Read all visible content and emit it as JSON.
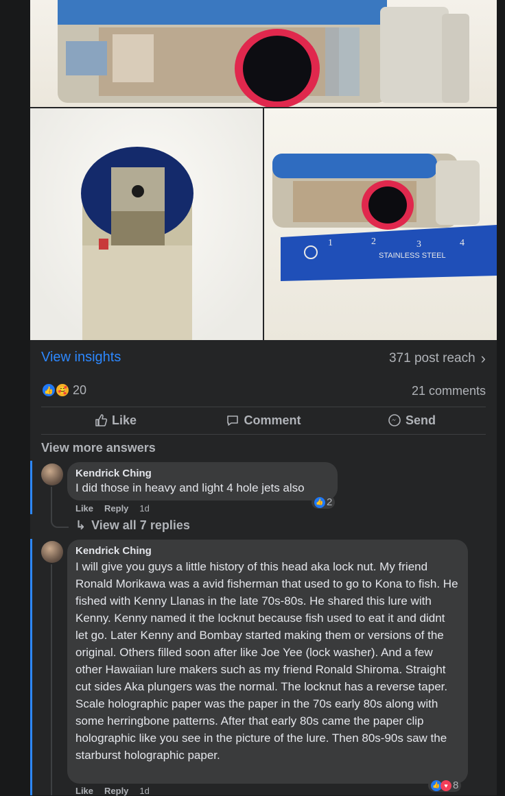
{
  "post": {
    "insights_label": "View insights",
    "reach": "371 post reach",
    "reaction_count": "20",
    "comments_count": "21 comments",
    "actions": {
      "like": "Like",
      "comment": "Comment",
      "send": "Send"
    },
    "ruler_text": "STAINLESS STEEL",
    "ruler_numbers": [
      "1",
      "2",
      "3",
      "4"
    ]
  },
  "comments_section": {
    "view_more": "View more answers",
    "comments": [
      {
        "author": "Kendrick Ching",
        "text": "I did those in heavy and light 4 hole jets also",
        "like": "Like",
        "reply": "Reply",
        "time": "1d",
        "reaction_count": "2",
        "view_replies": "View all 7 replies"
      },
      {
        "author": "Kendrick Ching",
        "text": "I will give you guys a little history of this head aka lock nut. My friend Ronald Morikawa was a avid fisherman that used to go to Kona to fish. He fished with Kenny Llanas in the late 70s-80s. He shared this lure with Kenny. Kenny named it the locknut because fish used to eat it and didnt let go. Later Kenny and Bombay started making them or versions of the original. Others filled soon after like Joe Yee (lock washer). And a few other Hawaiian lure makers such as my friend Ronald Shiroma. Straight cut sides Aka plungers was the normal. The locknut has a reverse taper. Scale holographic paper was the paper in the 70s early 80s along with some herringbone patterns. After that early 80s came the paper clip holographic like you see in the picture of the lure. Then 80s-90s saw the starburst holographic paper.",
        "like": "Like",
        "reply": "Reply",
        "time": "1d",
        "reaction_count": "8"
      }
    ]
  },
  "colors": {
    "accent": "#2d88ff",
    "background": "#18191a",
    "card": "#242526",
    "bubble": "#3a3b3c"
  }
}
